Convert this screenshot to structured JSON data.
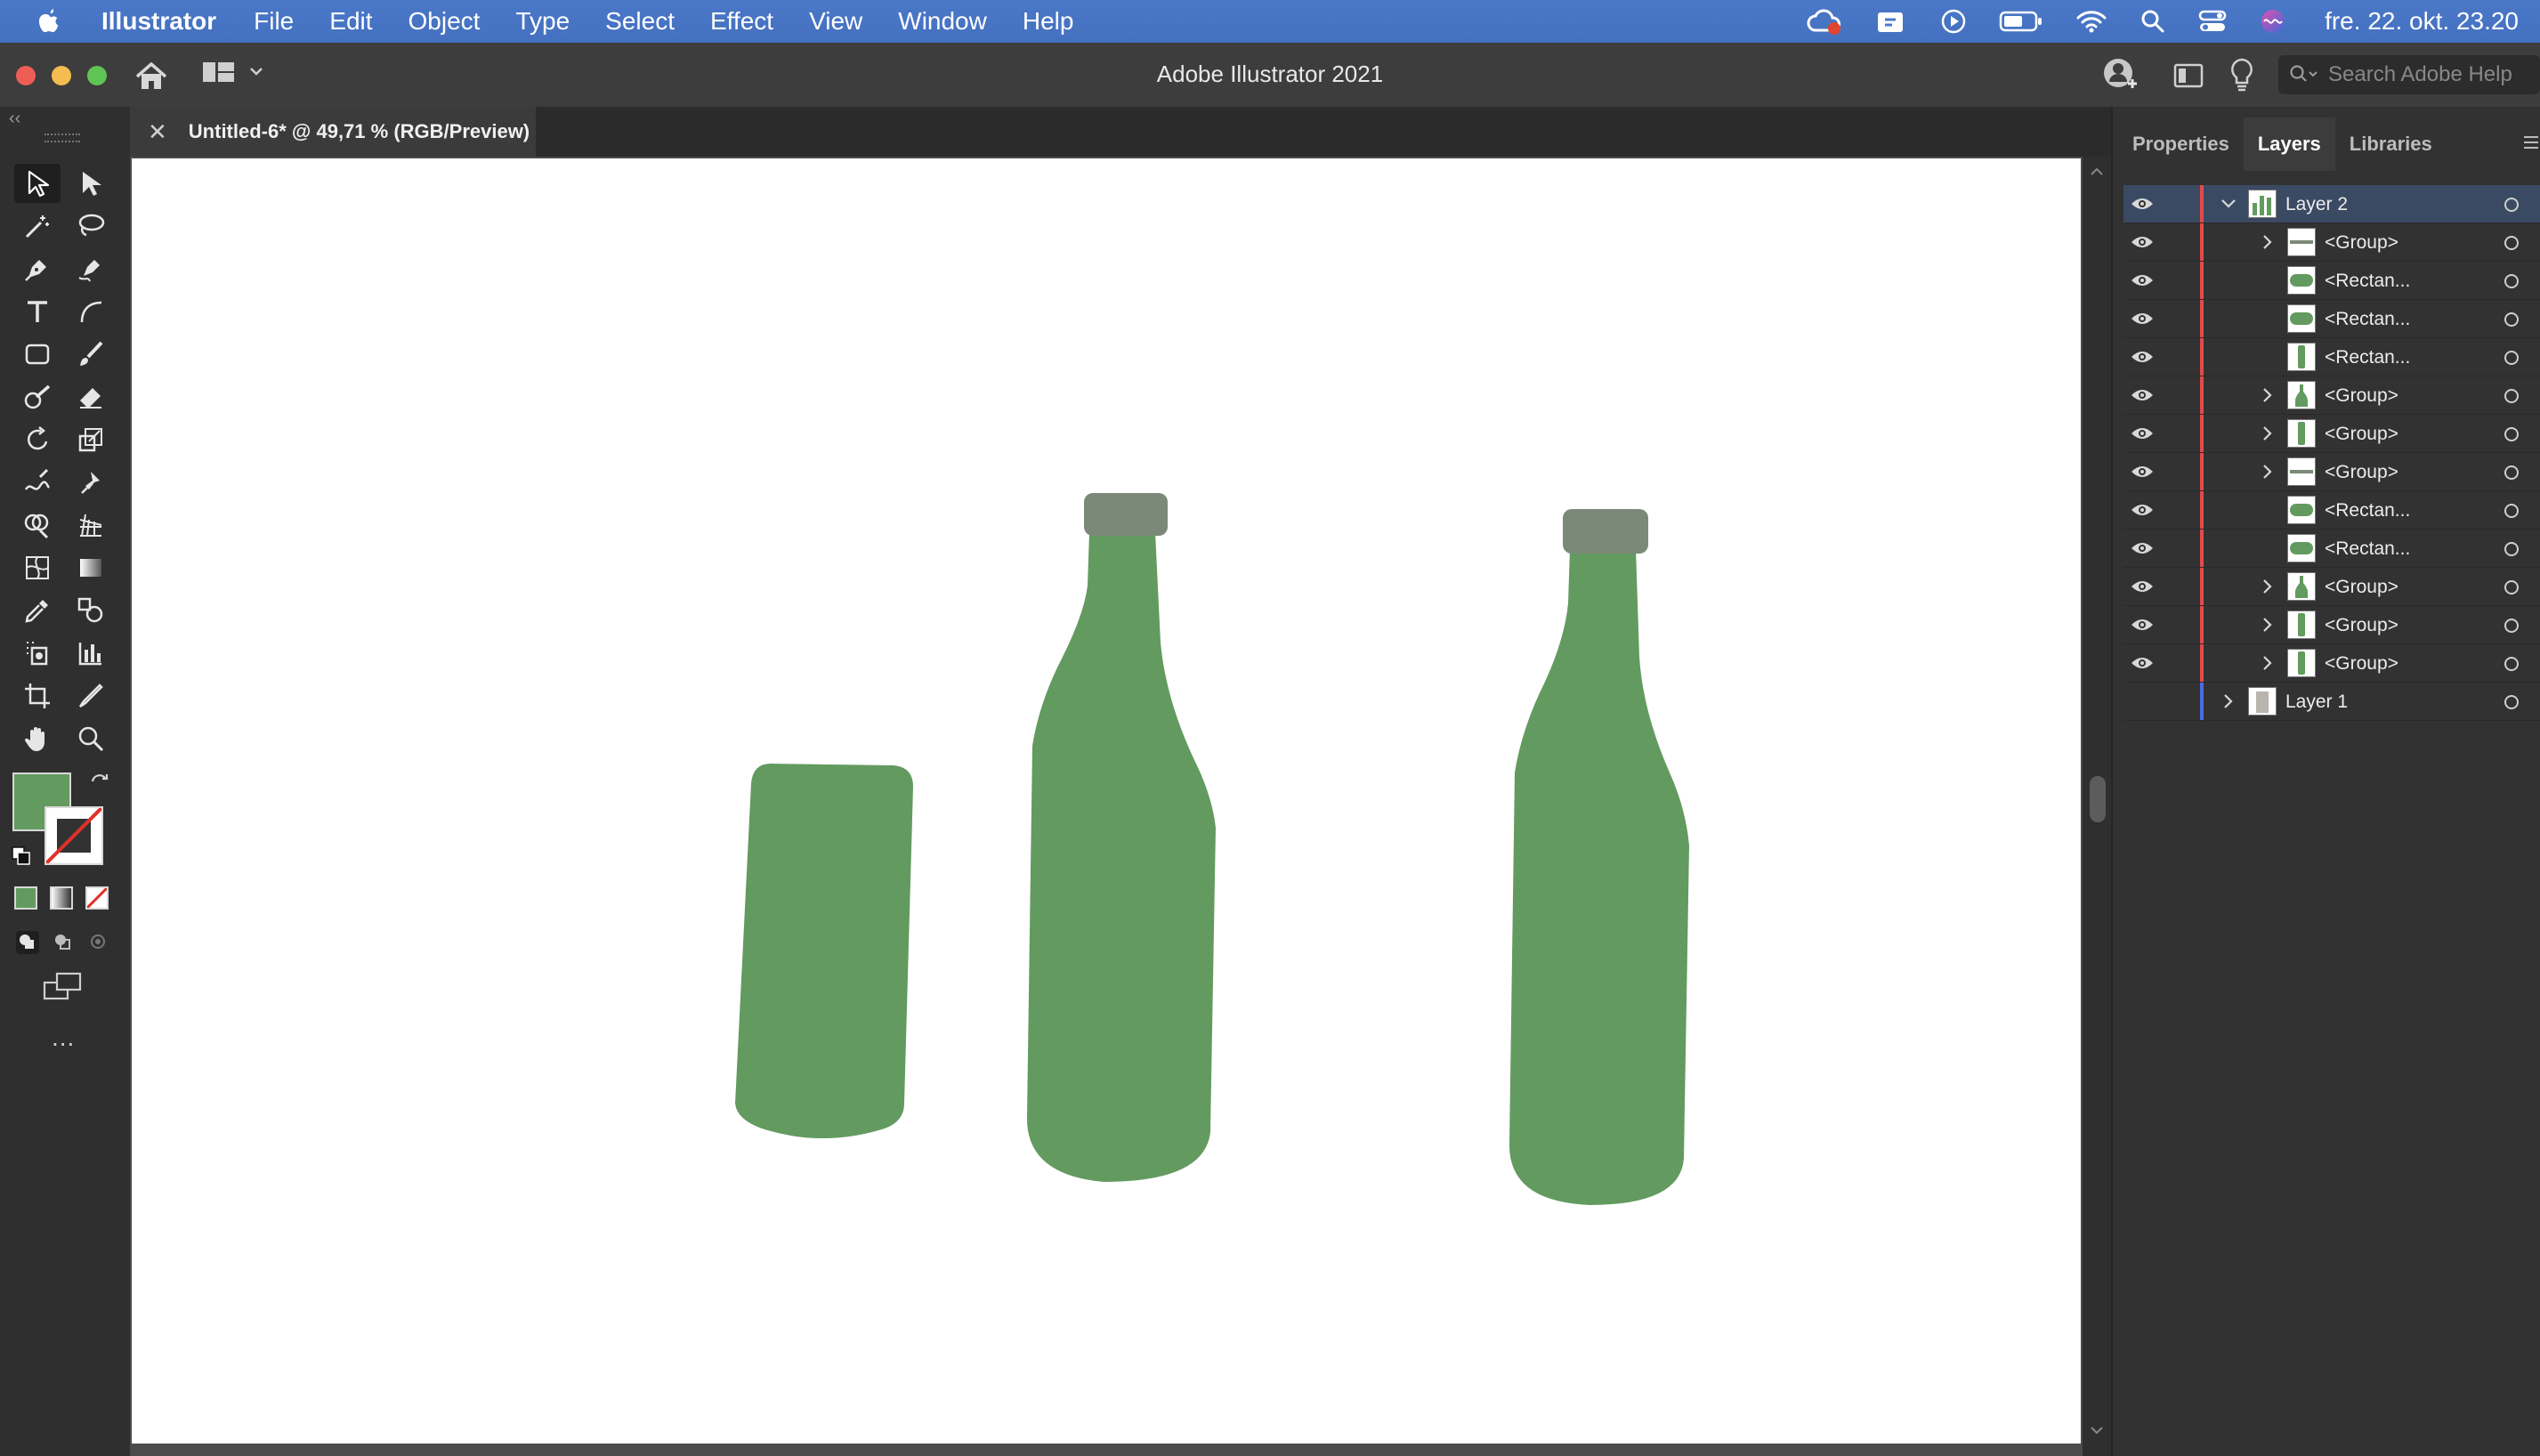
{
  "menubar": {
    "app_name": "Illustrator",
    "items": [
      "File",
      "Edit",
      "Object",
      "Type",
      "Select",
      "Effect",
      "View",
      "Window",
      "Help"
    ],
    "clock": "fre. 22. okt. 23.20"
  },
  "window": {
    "title": "Adobe Illustrator 2021",
    "search_placeholder": "Search Adobe Help"
  },
  "document_tab": {
    "label": "Untitled-6* @ 49,71 % (RGB/Preview)"
  },
  "toolbar": {
    "fill_color": "#639a60",
    "more_label": "..."
  },
  "panel": {
    "tabs": [
      "Properties",
      "Layers",
      "Libraries"
    ],
    "active_tab": "Layers",
    "layers": [
      {
        "name": "Layer 2",
        "depth": 0,
        "expand": "open",
        "color": "#e04b4b",
        "thumb": "bottles",
        "selected": true,
        "visible": true
      },
      {
        "name": "<Group>",
        "depth": 1,
        "expand": "closed",
        "color": "#e04b4b",
        "thumb": "stripe",
        "visible": true
      },
      {
        "name": "<Rectan...",
        "depth": 1,
        "expand": "none",
        "color": "#e04b4b",
        "thumb": "pill",
        "visible": true
      },
      {
        "name": "<Rectan...",
        "depth": 1,
        "expand": "none",
        "color": "#e04b4b",
        "thumb": "pill",
        "visible": true
      },
      {
        "name": "<Rectan...",
        "depth": 1,
        "expand": "none",
        "color": "#e04b4b",
        "thumb": "tall",
        "visible": true
      },
      {
        "name": "<Group>",
        "depth": 1,
        "expand": "closed",
        "color": "#e04b4b",
        "thumb": "bottle",
        "visible": true
      },
      {
        "name": "<Group>",
        "depth": 1,
        "expand": "closed",
        "color": "#e04b4b",
        "thumb": "tall",
        "visible": true
      },
      {
        "name": "<Group>",
        "depth": 1,
        "expand": "closed",
        "color": "#e04b4b",
        "thumb": "stripe",
        "visible": true
      },
      {
        "name": "<Rectan...",
        "depth": 1,
        "expand": "none",
        "color": "#e04b4b",
        "thumb": "pill",
        "visible": true
      },
      {
        "name": "<Rectan...",
        "depth": 1,
        "expand": "none",
        "color": "#e04b4b",
        "thumb": "pill",
        "visible": true
      },
      {
        "name": "<Group>",
        "depth": 1,
        "expand": "closed",
        "color": "#e04b4b",
        "thumb": "bottle",
        "visible": true
      },
      {
        "name": "<Group>",
        "depth": 1,
        "expand": "closed",
        "color": "#e04b4b",
        "thumb": "tall",
        "visible": true
      },
      {
        "name": "<Group>",
        "depth": 1,
        "expand": "closed",
        "color": "#e04b4b",
        "thumb": "tall",
        "visible": true
      },
      {
        "name": "Layer 1",
        "depth": 0,
        "expand": "closed",
        "color": "#4a6ee0",
        "thumb": "sketch",
        "visible": false
      }
    ]
  },
  "artwork": {
    "bottle_color": "#639a60",
    "cap_color": "#7b8a78"
  }
}
